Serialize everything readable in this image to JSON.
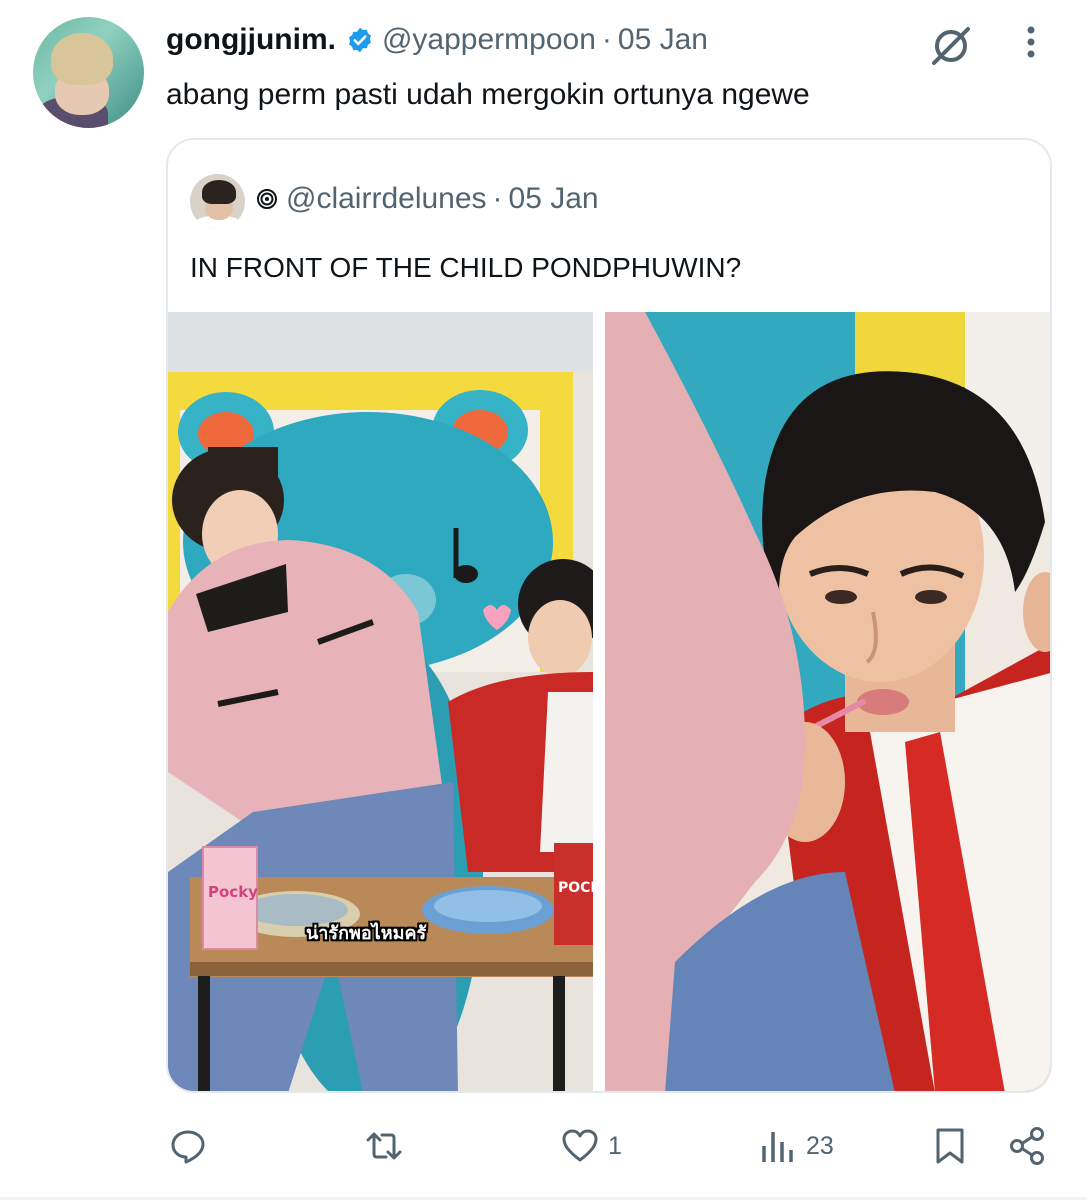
{
  "tweet": {
    "display_name": "gongjjunim.",
    "handle": "@yappermpoon",
    "separator": "·",
    "date": "05 Jan",
    "text": "abang perm pasti udah mergokin ortunya ngewe",
    "verified_color": "#1d9bf0"
  },
  "quote": {
    "handle": "@clairrdelunes",
    "separator": "·",
    "date": "05 Jan",
    "text": "IN FRONT OF THE CHILD PONDPHUWIN?",
    "media": {
      "left_caption": "น่ารักพอไหมครั",
      "left_box_label": "Pocky",
      "right_box_label": "POCK"
    }
  },
  "actions": {
    "reply": {
      "icon": "reply-icon"
    },
    "repost": {
      "icon": "repost-icon"
    },
    "like": {
      "icon": "heart-icon",
      "count": "1"
    },
    "views": {
      "icon": "views-icon",
      "count": "23"
    },
    "bookmark": {
      "icon": "bookmark-icon"
    },
    "share": {
      "icon": "share-icon"
    }
  },
  "colors": {
    "text": "#0f1419",
    "secondary": "#536471",
    "border": "#e4e9ec",
    "accent": "#1d9bf0"
  }
}
